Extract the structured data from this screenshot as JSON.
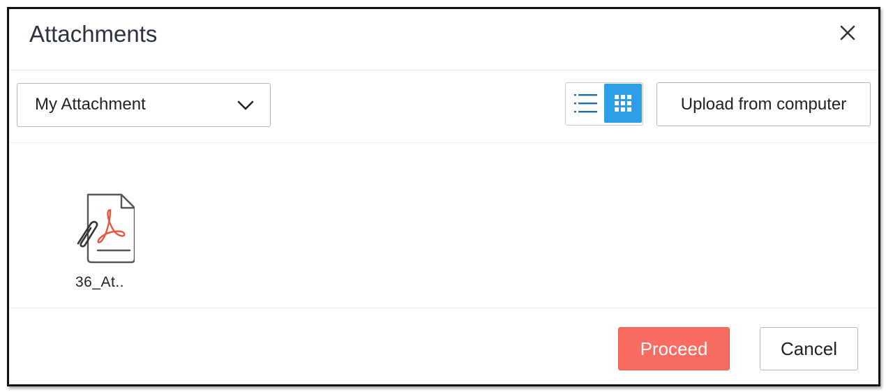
{
  "dialog": {
    "title": "Attachments",
    "close_icon": "close-icon"
  },
  "toolbar": {
    "source_select": {
      "selected": "My Attachment",
      "icon": "chevron-down-icon"
    },
    "view_toggle": {
      "active": "grid",
      "list_icon": "list-view-icon",
      "grid_icon": "grid-view-icon",
      "active_color": "#2e9fe6"
    },
    "upload_label": "Upload from computer"
  },
  "files": [
    {
      "name": "36_At..",
      "icon": "pdf-attachment-icon"
    }
  ],
  "footer": {
    "proceed_label": "Proceed",
    "cancel_label": "Cancel",
    "proceed_color": "#fa6c62"
  }
}
